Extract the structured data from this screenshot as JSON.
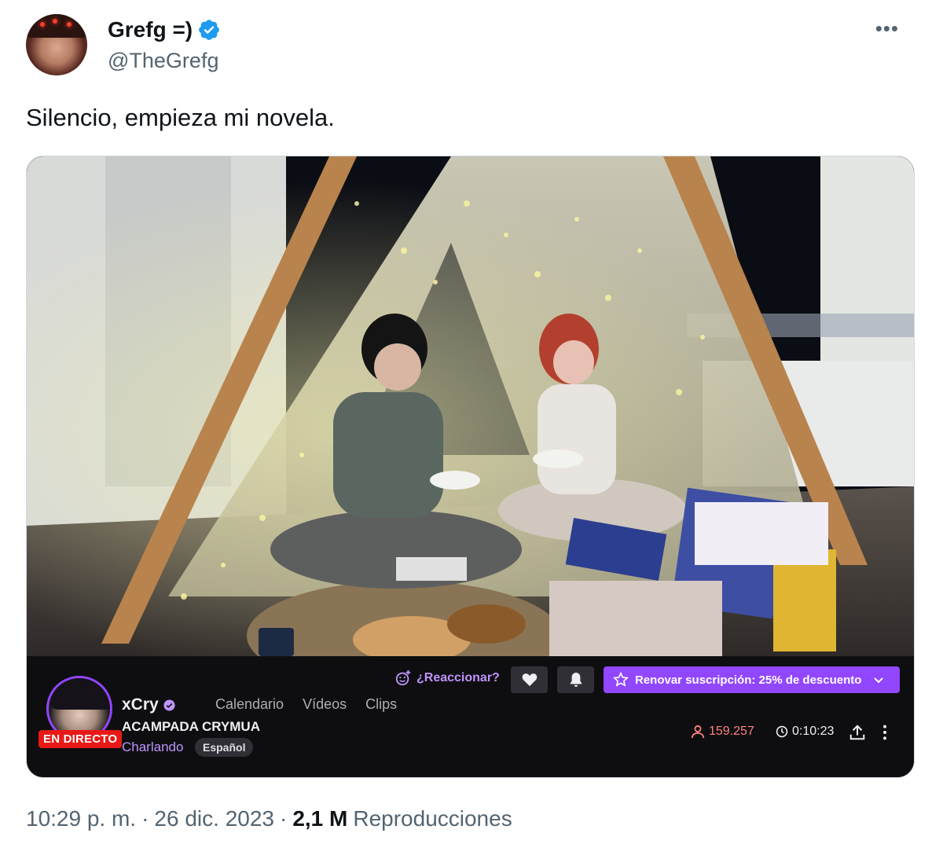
{
  "author": {
    "display_name": "Grefg =)",
    "handle": "@TheGrefg",
    "verified": true
  },
  "tweet": {
    "text": "Silencio, empieza mi novela."
  },
  "more_icon": "more-horizontal-icon",
  "stream": {
    "channel_name": "xCry",
    "live_badge": "EN DIRECTO",
    "nav": [
      "Calendario",
      "Vídeos",
      "Clips"
    ],
    "title": "ACAMPADA CRYMUA",
    "category": "Charlando",
    "tag": "Español",
    "react_label": "¿Reaccionar?",
    "renew_label": "Renovar suscripción: 25% de descuento",
    "viewers": "159.257",
    "uptime": "0:10:23",
    "accent_color": "#9146ff",
    "live_color": "#e91916"
  },
  "meta": {
    "time": "10:29 p. m.",
    "separator": "·",
    "date": "26 dic. 2023",
    "views_count": "2,1 M",
    "views_label": "Reproducciones"
  }
}
